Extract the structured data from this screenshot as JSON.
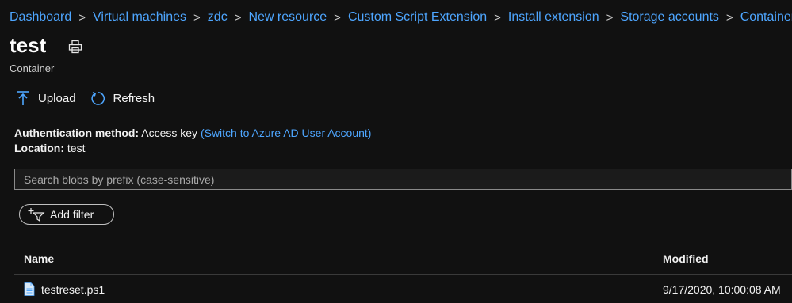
{
  "breadcrumb": [
    "Dashboard",
    "Virtual machines",
    "zdc",
    "New resource",
    "Custom Script Extension",
    "Install extension",
    "Storage accounts",
    "Containers"
  ],
  "breadcrumb_separator": ">",
  "page": {
    "title": "test",
    "subtitle": "Container"
  },
  "toolbar": {
    "upload_label": "Upload",
    "refresh_label": "Refresh"
  },
  "info": {
    "auth_label": "Authentication method:",
    "auth_value": "Access key",
    "auth_link": "(Switch to Azure AD User Account)",
    "location_label": "Location:",
    "location_value": "test"
  },
  "search": {
    "placeholder": "Search blobs by prefix (case-sensitive)",
    "value": ""
  },
  "filter": {
    "label": "Add filter"
  },
  "table": {
    "columns": {
      "name": "Name",
      "modified": "Modified"
    },
    "rows": [
      {
        "name": "testreset.ps1",
        "modified": "9/17/2020, 10:00:08 AM"
      }
    ]
  },
  "colors": {
    "background": "#111111",
    "link": "#4ea6ff",
    "text": "#f2f2f2"
  },
  "icons": {
    "upload": "upload-arrow-icon",
    "refresh": "refresh-icon",
    "print": "print-icon",
    "filter": "add-filter-icon",
    "file": "file-icon",
    "separator": "chevron-right-icon"
  }
}
